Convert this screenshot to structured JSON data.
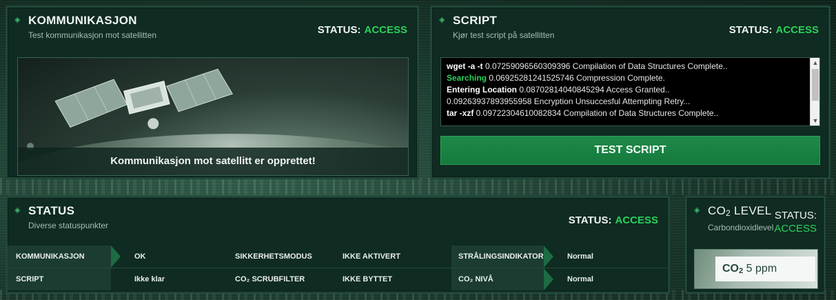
{
  "status_word": "STATUS:",
  "access_word": "ACCESS",
  "kommunikasjon": {
    "title": "KOMMUNIKASJON",
    "subtitle": "Test kommunikasjon mot satellitten",
    "caption": "Kommunikasjon mot satellitt er opprettet!"
  },
  "script": {
    "title": "SCRIPT",
    "subtitle": "Kjør test script på satellitten",
    "lines": [
      {
        "cmd": "wget -a -t",
        "cmd_style": "bold",
        "rest": " 0.07259096560309396 Compilation of Data Structures Complete.."
      },
      {
        "cmd": "Searching",
        "cmd_style": "green",
        "rest": " 0.06925281241525746 Compression Complete."
      },
      {
        "cmd": "Entering Location",
        "cmd_style": "bold",
        "rest": " 0.08702814040845294 Access Granted.."
      },
      {
        "cmd": "",
        "cmd_style": "none",
        "rest": "0.09263937893955958 Encryption Unsuccesful Attempting Retry..."
      },
      {
        "cmd": "tar -xzf",
        "cmd_style": "bold",
        "rest": " 0.09722304610082834 Compilation of Data Structures Complete.."
      }
    ],
    "button_label": "TEST SCRIPT"
  },
  "status_panel": {
    "title": "STATUS",
    "subtitle": "Diverse statuspunkter",
    "rows": [
      [
        "KOMMUNIKASJON",
        "OK",
        "SIKKERHETSMODUS",
        "IKKE AKTIVERT",
        "STRÅLINGSINDIKATOR",
        "Normal"
      ],
      [
        "SCRIPT",
        "Ikke klar",
        "CO₂ SCRUBFILTER",
        "IKKE BYTTET",
        "CO₂ NIVÅ",
        "Normal"
      ]
    ]
  },
  "co2": {
    "title_prefix": "CO",
    "title_sub": "2",
    "title_suffix": " LEVEL",
    "subtitle": "Carbondioxidlevel",
    "value_prefix": "CO",
    "value_sub": "2",
    "value": " 5 ppm"
  },
  "colors": {
    "access": "#2bd15a",
    "panel_bg": "#0f2b22",
    "button": "#1e8a49"
  }
}
